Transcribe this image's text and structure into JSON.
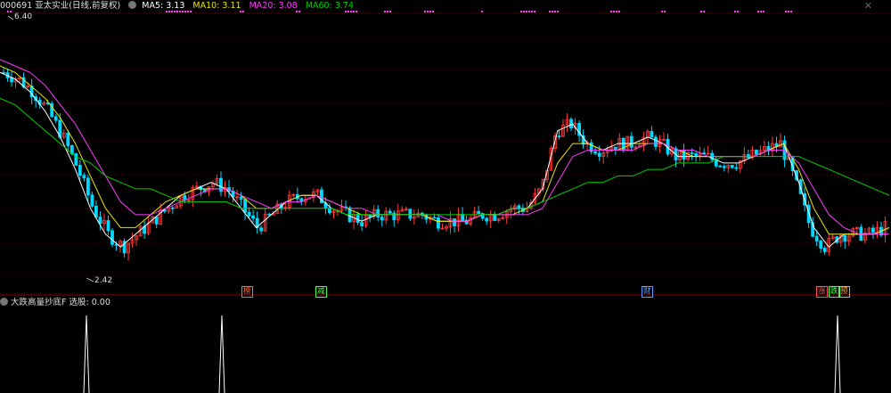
{
  "header": {
    "title": "000691 亚太实业(日线,前复权)",
    "ma5": "MA5: 3.13",
    "ma10": "MA10: 3.11",
    "ma20": "MA20: 3.08",
    "ma60": "MA60: 3.74",
    "close": "✕"
  },
  "price_labels": {
    "high": "6.40",
    "low": "2.42"
  },
  "event_tags": [
    "榜",
    "减",
    "财",
    "涨",
    "跌",
    "预"
  ],
  "indicator": {
    "title": "大跌高量抄底F  选股: 0.00"
  },
  "colors": {
    "up": "#ff3c3c",
    "down": "#00d8ff",
    "ma5": "#ffffff",
    "ma10": "#e8e800",
    "ma20": "#ff3cff",
    "ma60": "#00d000",
    "grid": "#a00000"
  },
  "chart_data": {
    "type": "line",
    "series": [
      {
        "name": "MA5",
        "values": [
          5.7,
          5.6,
          5.4,
          5.1,
          4.7,
          4.2,
          3.6,
          3.2,
          3.0,
          3.2,
          3.4,
          3.6,
          3.8,
          3.9,
          4.0,
          3.9,
          3.6,
          3.3,
          3.5,
          3.7,
          3.8,
          3.8,
          3.6,
          3.5,
          3.4,
          3.5,
          3.5,
          3.5,
          3.5,
          3.4,
          3.4,
          3.4,
          3.5,
          3.5,
          3.6,
          3.6,
          3.9,
          4.8,
          4.9,
          4.6,
          4.5,
          4.6,
          4.6,
          4.7,
          4.6,
          4.4,
          4.4,
          4.4,
          4.3,
          4.3,
          4.4,
          4.5,
          4.6,
          4.0,
          3.3,
          3.0,
          3.2,
          3.2,
          3.2,
          3.3
        ]
      },
      {
        "name": "MA10",
        "values": [
          5.8,
          5.7,
          5.5,
          5.3,
          5.0,
          4.6,
          4.1,
          3.6,
          3.3,
          3.3,
          3.5,
          3.7,
          3.8,
          3.9,
          3.9,
          3.9,
          3.8,
          3.6,
          3.6,
          3.7,
          3.8,
          3.8,
          3.7,
          3.6,
          3.5,
          3.5,
          3.5,
          3.5,
          3.5,
          3.4,
          3.4,
          3.4,
          3.5,
          3.5,
          3.5,
          3.6,
          3.7,
          4.3,
          4.6,
          4.6,
          4.5,
          4.5,
          4.6,
          4.6,
          4.6,
          4.5,
          4.4,
          4.4,
          4.4,
          4.4,
          4.4,
          4.5,
          4.6,
          4.2,
          3.6,
          3.2,
          3.2,
          3.2,
          3.2,
          3.3
        ]
      },
      {
        "name": "MA20",
        "values": [
          5.9,
          5.8,
          5.7,
          5.5,
          5.2,
          4.9,
          4.5,
          4.1,
          3.7,
          3.5,
          3.5,
          3.6,
          3.7,
          3.8,
          3.9,
          3.9,
          3.8,
          3.7,
          3.6,
          3.7,
          3.7,
          3.8,
          3.7,
          3.6,
          3.6,
          3.5,
          3.5,
          3.5,
          3.5,
          3.5,
          3.4,
          3.4,
          3.5,
          3.5,
          3.5,
          3.5,
          3.6,
          4.0,
          4.4,
          4.5,
          4.5,
          4.5,
          4.5,
          4.6,
          4.6,
          4.5,
          4.5,
          4.4,
          4.4,
          4.4,
          4.4,
          4.5,
          4.5,
          4.3,
          3.9,
          3.5,
          3.3,
          3.2,
          3.2,
          3.2
        ]
      },
      {
        "name": "MA60",
        "values": [
          5.3,
          5.2,
          5.0,
          4.8,
          4.6,
          4.4,
          4.3,
          4.1,
          4.0,
          3.9,
          3.9,
          3.8,
          3.7,
          3.7,
          3.7,
          3.7,
          3.6,
          3.6,
          3.6,
          3.6,
          3.6,
          3.6,
          3.6,
          3.5,
          3.5,
          3.5,
          3.5,
          3.5,
          3.5,
          3.5,
          3.5,
          3.5,
          3.5,
          3.5,
          3.6,
          3.6,
          3.7,
          3.8,
          3.9,
          4.0,
          4.0,
          4.1,
          4.1,
          4.2,
          4.2,
          4.3,
          4.3,
          4.3,
          4.4,
          4.4,
          4.4,
          4.4,
          4.4,
          4.4,
          4.3,
          4.2,
          4.1,
          4.0,
          3.9,
          3.8
        ]
      }
    ],
    "high": 6.4,
    "low": 2.42,
    "ylim": [
      2.3,
      6.6
    ]
  }
}
